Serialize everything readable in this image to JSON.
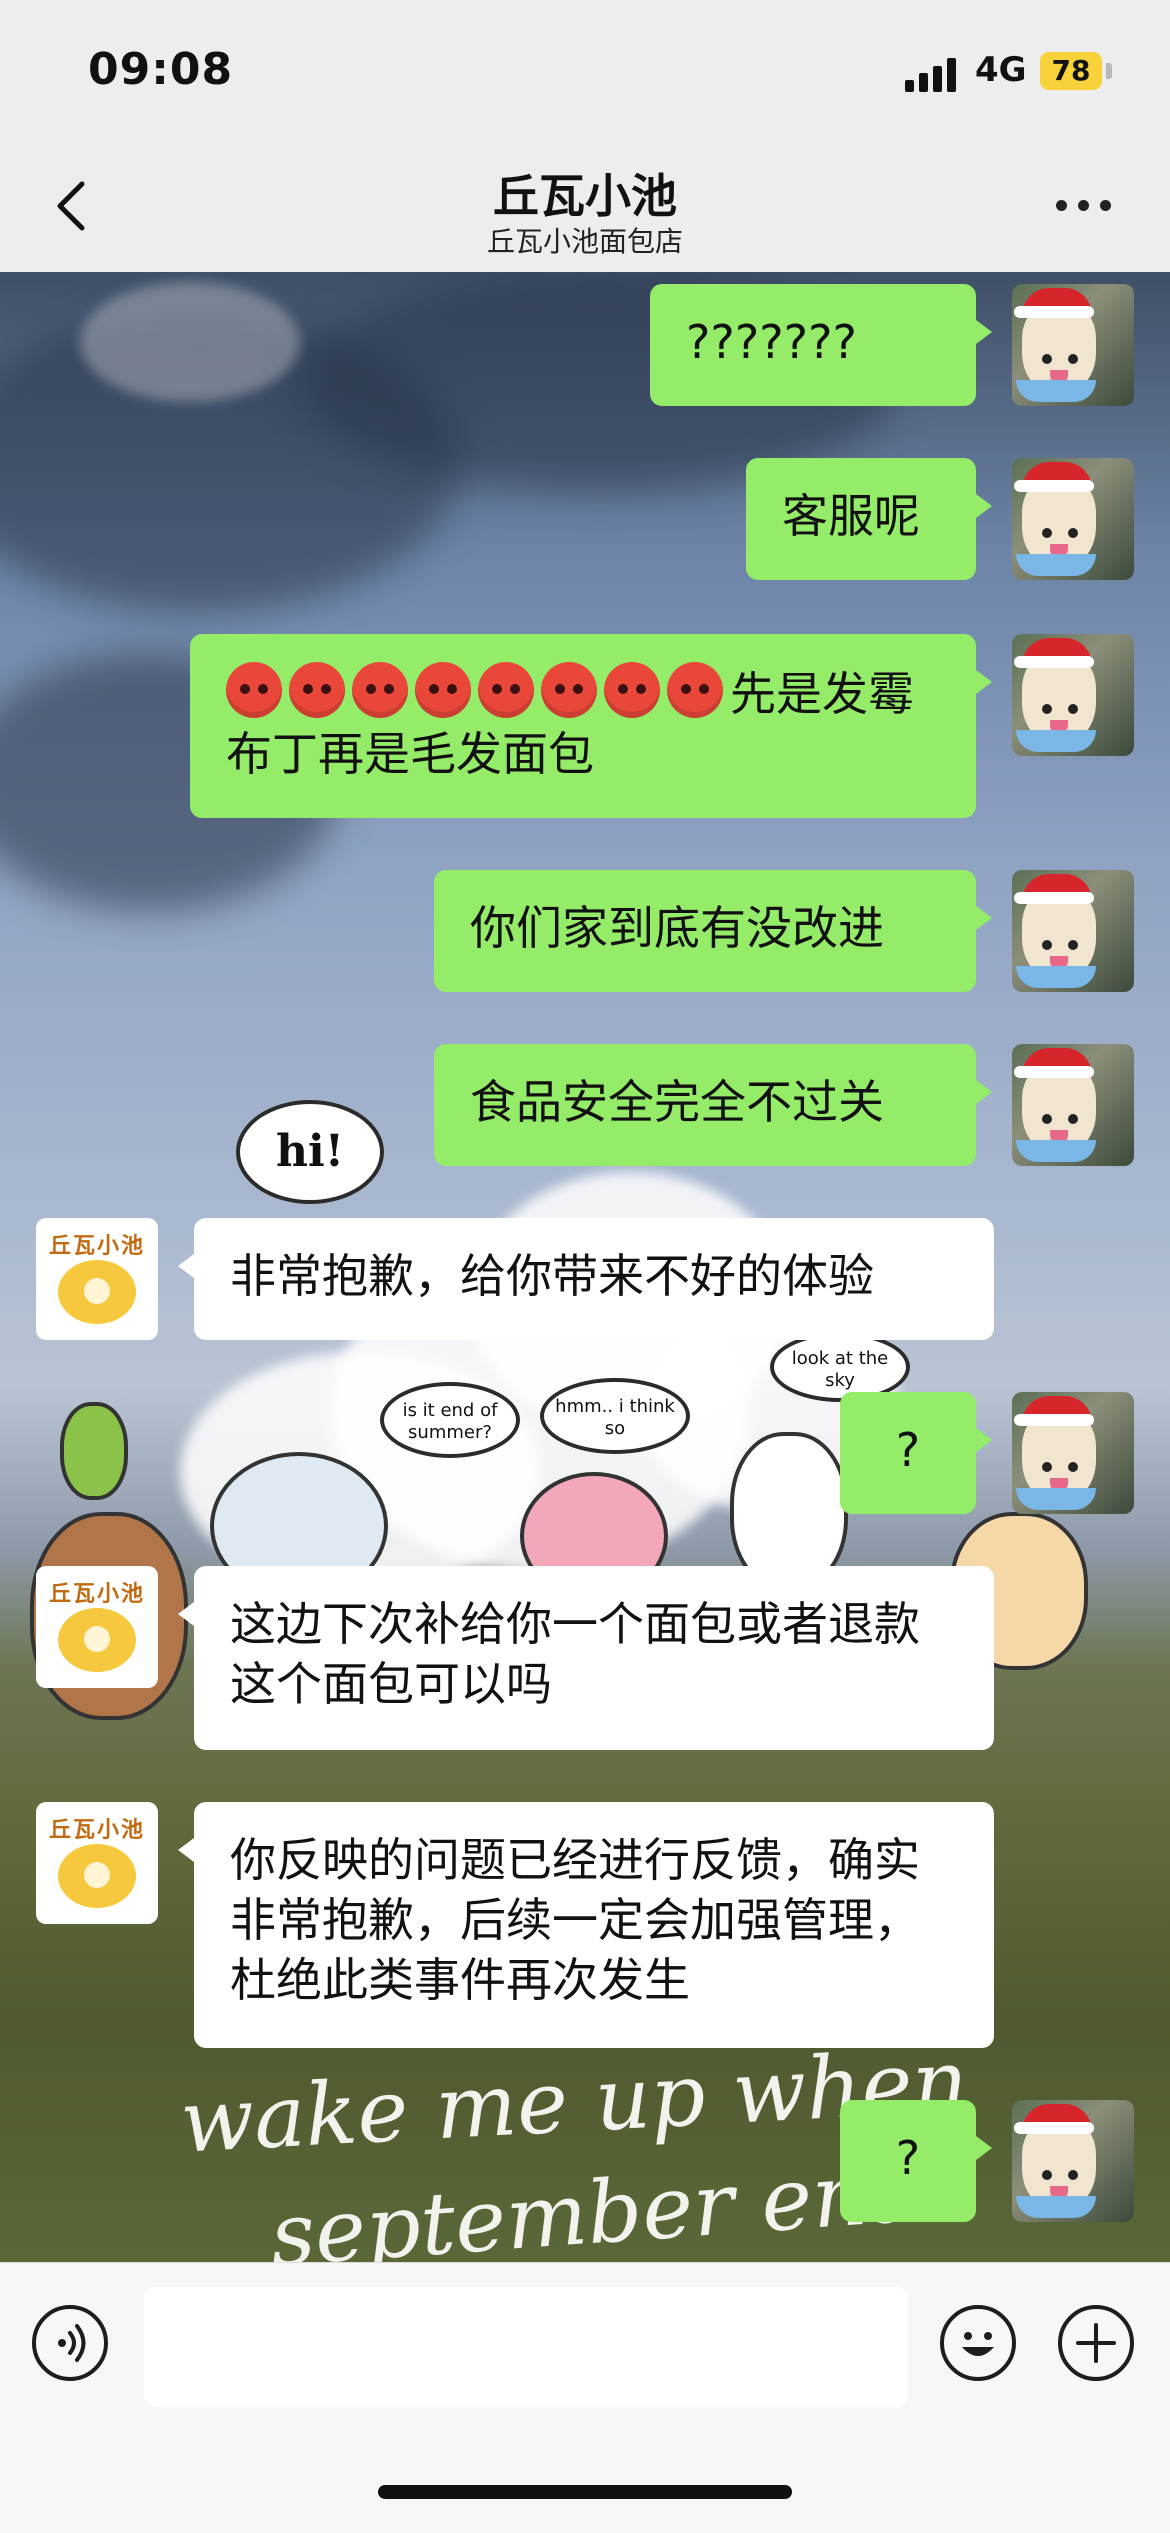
{
  "status_bar": {
    "time": "09:08",
    "network": "4G",
    "battery": "78"
  },
  "nav": {
    "title": "丘瓦小池",
    "subtitle": "丘瓦小池面包店",
    "back_icon": "chevron-left-icon",
    "more_icon": "more-dots-icon"
  },
  "wallpaper": {
    "hi": "hi!",
    "speech1": "is it end of summer?",
    "speech2": "hmm.. i think so",
    "speech3": "look at the sky",
    "bottom_text_1": "wake me up when",
    "bottom_text_2": "september ends"
  },
  "messages": [
    {
      "from": "me",
      "text": "???????"
    },
    {
      "from": "me",
      "text": "客服呢"
    },
    {
      "from": "me",
      "emoji_count": 8,
      "emoji_name": "angry-face",
      "text": "先是发霉布丁再是毛发面包"
    },
    {
      "from": "me",
      "text": "你们家到底有没改进"
    },
    {
      "from": "me",
      "text": "食品安全完全不过关"
    },
    {
      "from": "them",
      "text": "非常抱歉，给你带来不好的体验"
    },
    {
      "from": "me",
      "text": "?"
    },
    {
      "from": "them",
      "text": "这边下次补给你一个面包或者退款这个面包可以吗"
    },
    {
      "from": "them",
      "text": "你反映的问题已经进行反馈，确实非常抱歉，后续一定会加强管理，杜绝此类事件再次发生"
    },
    {
      "from": "me",
      "text": "?"
    }
  ],
  "shop_logo_text": "丘瓦小池",
  "input_bar": {
    "voice_icon": "voice-icon",
    "emoji_icon": "smile-icon",
    "plus_icon": "plus-icon",
    "placeholder": ""
  },
  "colors": {
    "my_bubble": "#95ec69",
    "their_bubble": "#ffffff",
    "header_bg": "#ededed",
    "battery": "#f7d23a"
  }
}
